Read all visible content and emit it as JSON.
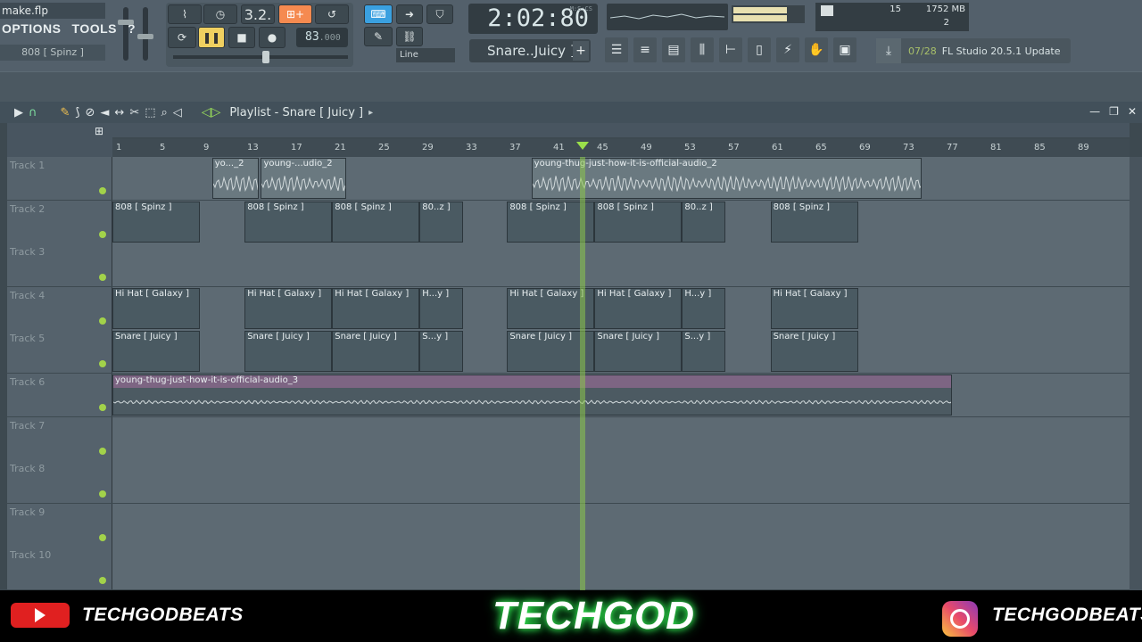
{
  "toolbar": {
    "filename": "make.flp",
    "menu": [
      "OPTIONS",
      "TOOLS",
      "?"
    ],
    "channel_name": "808 [ Spinz ]",
    "pattern_num": "3.2.",
    "tempo": "83",
    "tempo_frac": ".000",
    "time": "2:02:80",
    "time_unit": "M:S:CS",
    "pattern_selector": "Snare..Juicy ]",
    "pattern_add": "+",
    "snap": "Line",
    "cpu": "15",
    "memory": "1752 MB",
    "polyphony": "2",
    "news_date": "07/28",
    "news_text": "FL Studio 20.5.1 Update"
  },
  "playlist": {
    "title": "Playlist - Snare [ Juicy ]",
    "ruler": [
      "1",
      "5",
      "9",
      "13",
      "17",
      "21",
      "25",
      "29",
      "33",
      "37",
      "41",
      "45",
      "49",
      "53",
      "57",
      "61",
      "65",
      "69",
      "73",
      "77",
      "81",
      "85",
      "89"
    ],
    "tracks": [
      {
        "name": "Track 1",
        "clips": [
          {
            "label": "yo..._2",
            "start": 0.098,
            "width": 0.046,
            "type": "audio"
          },
          {
            "label": "young-...udio_2",
            "start": 0.146,
            "width": 0.084,
            "type": "audio"
          },
          {
            "label": "young-thug-just-how-it-is-official-audio_2",
            "start": 0.412,
            "width": 0.384,
            "type": "audio"
          }
        ]
      },
      {
        "name": "Track 2",
        "clips": [
          {
            "label": "808 [ Spinz ]",
            "start": 0.0,
            "width": 0.086
          },
          {
            "label": "808 [ Spinz ]",
            "start": 0.13,
            "width": 0.086
          },
          {
            "label": "808 [ Spinz ]",
            "start": 0.216,
            "width": 0.086
          },
          {
            "label": "80..z ]",
            "start": 0.302,
            "width": 0.043
          },
          {
            "label": "808 [ Spinz ]",
            "start": 0.388,
            "width": 0.086
          },
          {
            "label": "808 [ Spinz ]",
            "start": 0.474,
            "width": 0.086
          },
          {
            "label": "80..z ]",
            "start": 0.56,
            "width": 0.043
          },
          {
            "label": "808 [ Spinz ]",
            "start": 0.647,
            "width": 0.086
          }
        ]
      },
      {
        "name": "Track 3",
        "clips": []
      },
      {
        "name": "Track 4",
        "clips": [
          {
            "label": "Hi Hat [ Galaxy ]",
            "start": 0.0,
            "width": 0.086
          },
          {
            "label": "Hi Hat [ Galaxy ]",
            "start": 0.13,
            "width": 0.086
          },
          {
            "label": "Hi Hat [ Galaxy ]",
            "start": 0.216,
            "width": 0.086
          },
          {
            "label": "H...y ]",
            "start": 0.302,
            "width": 0.043
          },
          {
            "label": "Hi Hat [ Galaxy ]",
            "start": 0.388,
            "width": 0.086
          },
          {
            "label": "Hi Hat [ Galaxy ]",
            "start": 0.474,
            "width": 0.086
          },
          {
            "label": "H...y ]",
            "start": 0.56,
            "width": 0.043
          },
          {
            "label": "Hi Hat [ Galaxy ]",
            "start": 0.647,
            "width": 0.086
          }
        ]
      },
      {
        "name": "Track 5",
        "clips": [
          {
            "label": "Snare [ Juicy ]",
            "start": 0.0,
            "width": 0.086
          },
          {
            "label": "Snare [ Juicy ]",
            "start": 0.13,
            "width": 0.086
          },
          {
            "label": "Snare [ Juicy ]",
            "start": 0.216,
            "width": 0.086
          },
          {
            "label": "S...y ]",
            "start": 0.302,
            "width": 0.043
          },
          {
            "label": "Snare [ Juicy ]",
            "start": 0.388,
            "width": 0.086
          },
          {
            "label": "Snare [ Juicy ]",
            "start": 0.474,
            "width": 0.086
          },
          {
            "label": "S...y ]",
            "start": 0.56,
            "width": 0.043
          },
          {
            "label": "Snare [ Juicy ]",
            "start": 0.647,
            "width": 0.086
          }
        ]
      },
      {
        "name": "Track 6",
        "clips": [
          {
            "label": "young-thug-just-how-it-is-official-audio_3",
            "start": 0.0,
            "width": 0.825,
            "type": "audio6"
          }
        ]
      },
      {
        "name": "Track 7",
        "clips": []
      },
      {
        "name": "Track 8",
        "clips": []
      },
      {
        "name": "Track 9",
        "clips": []
      },
      {
        "name": "Track 10",
        "clips": []
      }
    ]
  },
  "footer": {
    "youtube": "TECHGODBEATS",
    "brand": "TECHGOD",
    "instagram": "TECHGODBEATS"
  },
  "colors": {
    "accent_orange": "#f58a50",
    "accent_blue": "#3aa0e0",
    "playhead_green": "#8cc84a",
    "brand_glow": "#3cff5a"
  }
}
